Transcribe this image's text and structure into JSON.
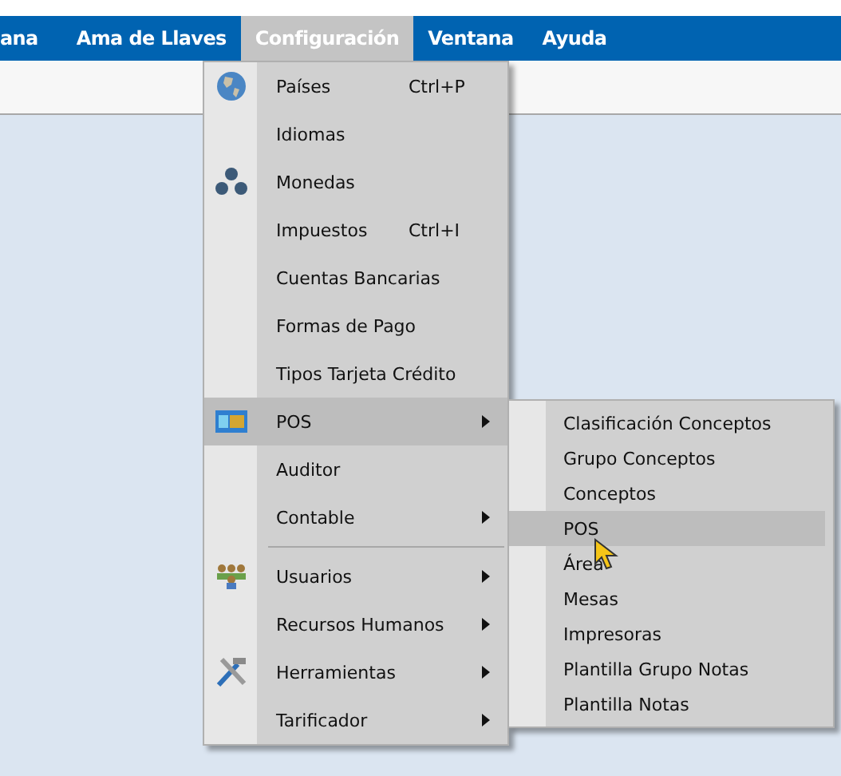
{
  "menubar": [
    {
      "label": "ana",
      "selected": false
    },
    {
      "label": "Ama de Llaves",
      "selected": false
    },
    {
      "label": "Configuración",
      "selected": true
    },
    {
      "label": "Ventana",
      "selected": false
    },
    {
      "label": "Ayuda",
      "selected": false
    }
  ],
  "menu": [
    {
      "kind": "item",
      "label": "Países",
      "shortcut": "Ctrl+P",
      "submenu": false,
      "selected": false
    },
    {
      "kind": "item",
      "label": "Idiomas",
      "submenu": false,
      "selected": false
    },
    {
      "kind": "item",
      "label": "Monedas",
      "submenu": false,
      "selected": false
    },
    {
      "kind": "item",
      "label": "Impuestos",
      "shortcut": "Ctrl+I",
      "submenu": false,
      "selected": false
    },
    {
      "kind": "item",
      "label": "Cuentas Bancarias",
      "submenu": false,
      "selected": false
    },
    {
      "kind": "item",
      "label": "Formas de Pago",
      "submenu": false,
      "selected": false
    },
    {
      "kind": "item",
      "label": "Tipos Tarjeta Crédito",
      "submenu": false,
      "selected": false
    },
    {
      "kind": "item",
      "label": "POS",
      "submenu": true,
      "selected": true
    },
    {
      "kind": "item",
      "label": "Auditor",
      "submenu": false,
      "selected": false
    },
    {
      "kind": "item",
      "label": "Contable",
      "submenu": true,
      "selected": false
    },
    {
      "kind": "separator"
    },
    {
      "kind": "item",
      "label": "Usuarios",
      "submenu": true,
      "selected": false
    },
    {
      "kind": "item",
      "label": "Recursos Humanos",
      "submenu": true,
      "selected": false
    },
    {
      "kind": "item",
      "label": "Herramientas",
      "submenu": true,
      "selected": false
    },
    {
      "kind": "item",
      "label": "Tarificador",
      "submenu": true,
      "selected": false
    }
  ],
  "submenu": [
    {
      "label": "Clasificación Conceptos",
      "selected": false
    },
    {
      "label": "Grupo Conceptos",
      "selected": false
    },
    {
      "label": "Conceptos",
      "selected": false
    },
    {
      "label": "POS",
      "selected": true
    },
    {
      "label": "Área",
      "selected": false
    },
    {
      "label": "Mesas",
      "selected": false
    },
    {
      "label": "Impresoras",
      "selected": false
    },
    {
      "label": "Plantilla Grupo Notas",
      "selected": false
    },
    {
      "label": "Plantilla Notas",
      "selected": false
    }
  ]
}
